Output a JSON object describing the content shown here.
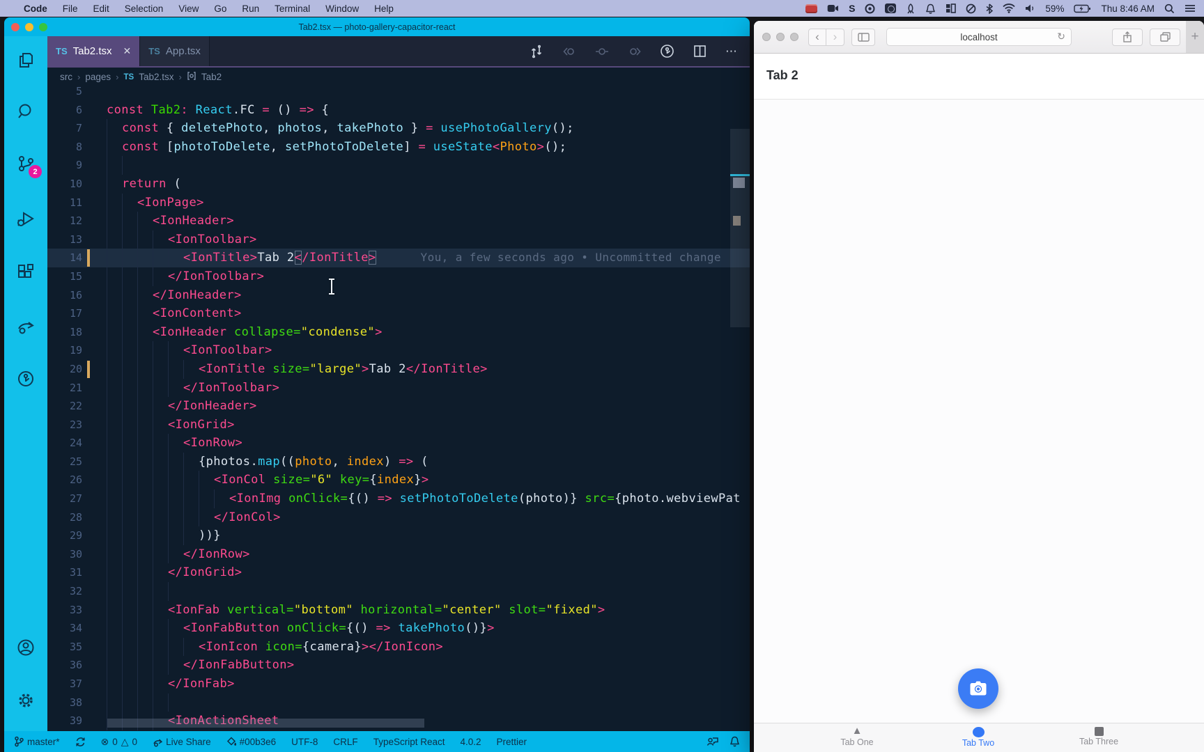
{
  "colors": {
    "accent_cyan": "#00b3e6",
    "tab_purple": "#57497c",
    "badge_magenta": "#e8189e",
    "fab_blue": "#3880ff",
    "ionic_active_blue": "#3478f6",
    "gutter_modified": "#d9a95e"
  },
  "menu_bar": {
    "apple": "",
    "menus": [
      "Code",
      "File",
      "Edit",
      "Selection",
      "View",
      "Go",
      "Run",
      "Terminal",
      "Window",
      "Help"
    ],
    "status_icons": [
      "film-icon",
      "video-camera-icon",
      "s-app-icon",
      "record-icon",
      "camera-square-icon",
      "rocket-icon",
      "bell-icon",
      "layout-icon",
      "slash-circle-icon",
      "bluetooth-icon",
      "wifi-icon",
      "volume-icon"
    ],
    "battery": "59%",
    "clock": "Thu 8:46 AM"
  },
  "vscode": {
    "window_title": "Tab2.tsx — photo-gallery-capacitor-react",
    "tabs": [
      {
        "icon": "TS",
        "label": "Tab2.tsx",
        "close": "✕",
        "active": true
      },
      {
        "icon": "TS",
        "label": "App.tsx",
        "active": false
      }
    ],
    "breadcrumb": [
      "src",
      "pages",
      "Tab2.tsx",
      "Tab2"
    ],
    "breadcrumb_ts": "TS",
    "activity_badge": "2",
    "editor": {
      "blame": "You, a few seconds ago • Uncommitted change",
      "lines": [
        {
          "n": 5,
          "i": 0,
          "t": []
        },
        {
          "n": 6,
          "i": 0,
          "t": [
            [
              "k",
              "const"
            ],
            [
              "w",
              " "
            ],
            [
              "g",
              "Tab2"
            ],
            [
              "k",
              ":"
            ],
            [
              "w",
              " "
            ],
            [
              "f",
              "React"
            ],
            [
              "w",
              ".FC "
            ],
            [
              "k",
              "="
            ],
            [
              "w",
              " () "
            ],
            [
              "k",
              "=>"
            ],
            [
              "w",
              " {"
            ]
          ]
        },
        {
          "n": 7,
          "i": 1,
          "t": [
            [
              "k",
              "const"
            ],
            [
              "w",
              " { "
            ],
            [
              "v",
              "deletePhoto"
            ],
            [
              "w",
              ", "
            ],
            [
              "v",
              "photos"
            ],
            [
              "w",
              ", "
            ],
            [
              "v",
              "takePhoto"
            ],
            [
              "w",
              " } "
            ],
            [
              "k",
              "="
            ],
            [
              "w",
              " "
            ],
            [
              "f",
              "usePhotoGallery"
            ],
            [
              "w",
              "();"
            ]
          ]
        },
        {
          "n": 8,
          "i": 1,
          "t": [
            [
              "k",
              "const"
            ],
            [
              "w",
              " ["
            ],
            [
              "v",
              "photoToDelete"
            ],
            [
              "w",
              ", "
            ],
            [
              "v",
              "setPhotoToDelete"
            ],
            [
              "w",
              "] "
            ],
            [
              "k",
              "="
            ],
            [
              "w",
              " "
            ],
            [
              "f",
              "useState"
            ],
            [
              "k",
              "<"
            ],
            [
              "o",
              "Photo"
            ],
            [
              "k",
              ">"
            ],
            [
              "w",
              "();"
            ]
          ]
        },
        {
          "n": 9,
          "i": 2,
          "t": []
        },
        {
          "n": 10,
          "i": 1,
          "t": [
            [
              "k",
              "return"
            ],
            [
              "w",
              " ("
            ]
          ]
        },
        {
          "n": 11,
          "i": 2,
          "t": [
            [
              "k",
              "<IonPage>"
            ]
          ]
        },
        {
          "n": 12,
          "i": 3,
          "t": [
            [
              "k",
              "<IonHeader>"
            ]
          ]
        },
        {
          "n": 13,
          "i": 4,
          "t": [
            [
              "k",
              "<IonToolbar>"
            ]
          ]
        },
        {
          "n": 14,
          "i": 5,
          "cur": true,
          "mod": true,
          "blame": true,
          "t": [
            [
              "k",
              "<IonTitle>"
            ],
            [
              "w",
              "Tab 2"
            ],
            [
              "b",
              "<"
            ],
            [
              "k",
              "/IonTitle"
            ],
            [
              "b",
              ">"
            ]
          ]
        },
        {
          "n": 15,
          "i": 4,
          "t": [
            [
              "k",
              "</IonToolbar>"
            ]
          ]
        },
        {
          "n": 16,
          "i": 3,
          "t": [
            [
              "k",
              "</IonHeader>"
            ]
          ]
        },
        {
          "n": 17,
          "i": 3,
          "t": [
            [
              "k",
              "<IonContent>"
            ]
          ]
        },
        {
          "n": 18,
          "i": 3,
          "t": [
            [
              "k",
              "<IonHeader"
            ],
            [
              "w",
              " "
            ],
            [
              "a",
              "collapse="
            ],
            [
              "s",
              "\"condense\""
            ],
            [
              "k",
              ">"
            ]
          ]
        },
        {
          "n": 19,
          "i": 5,
          "t": [
            [
              "k",
              "<IonToolbar>"
            ]
          ]
        },
        {
          "n": 20,
          "i": 6,
          "mod": true,
          "t": [
            [
              "k",
              "<IonTitle"
            ],
            [
              "w",
              " "
            ],
            [
              "a",
              "size="
            ],
            [
              "s",
              "\"large\""
            ],
            [
              "k",
              ">"
            ],
            [
              "w",
              "Tab 2"
            ],
            [
              "k",
              "</IonTitle>"
            ]
          ]
        },
        {
          "n": 21,
          "i": 5,
          "t": [
            [
              "k",
              "</IonToolbar>"
            ]
          ]
        },
        {
          "n": 22,
          "i": 4,
          "t": [
            [
              "k",
              "</IonHeader>"
            ]
          ]
        },
        {
          "n": 23,
          "i": 4,
          "t": [
            [
              "k",
              "<IonGrid>"
            ]
          ]
        },
        {
          "n": 24,
          "i": 5,
          "t": [
            [
              "k",
              "<IonRow>"
            ]
          ]
        },
        {
          "n": 25,
          "i": 6,
          "t": [
            [
              "w",
              "{photos."
            ],
            [
              "f",
              "map"
            ],
            [
              "w",
              "(("
            ],
            [
              "o",
              "photo"
            ],
            [
              "w",
              ", "
            ],
            [
              "o",
              "index"
            ],
            [
              "w",
              ") "
            ],
            [
              "k",
              "=>"
            ],
            [
              "w",
              " ("
            ]
          ]
        },
        {
          "n": 26,
          "i": 7,
          "t": [
            [
              "k",
              "<IonCol"
            ],
            [
              "w",
              " "
            ],
            [
              "a",
              "size="
            ],
            [
              "s",
              "\"6\""
            ],
            [
              "w",
              " "
            ],
            [
              "a",
              "key="
            ],
            [
              "w",
              "{"
            ],
            [
              "o",
              "index"
            ],
            [
              "w",
              "}"
            ],
            [
              "k",
              ">"
            ]
          ]
        },
        {
          "n": 27,
          "i": 8,
          "t": [
            [
              "k",
              "<IonImg"
            ],
            [
              "w",
              " "
            ],
            [
              "a",
              "onClick="
            ],
            [
              "w",
              "{() "
            ],
            [
              "k",
              "=>"
            ],
            [
              "w",
              " "
            ],
            [
              "f",
              "setPhotoToDelete"
            ],
            [
              "w",
              "(photo)} "
            ],
            [
              "a",
              "src="
            ],
            [
              "w",
              "{photo.webviewPat"
            ]
          ]
        },
        {
          "n": 28,
          "i": 7,
          "t": [
            [
              "k",
              "</IonCol>"
            ]
          ]
        },
        {
          "n": 29,
          "i": 6,
          "t": [
            [
              "w",
              "))}"
            ]
          ]
        },
        {
          "n": 30,
          "i": 5,
          "t": [
            [
              "k",
              "</IonRow>"
            ]
          ]
        },
        {
          "n": 31,
          "i": 4,
          "t": [
            [
              "k",
              "</IonGrid>"
            ]
          ]
        },
        {
          "n": 32,
          "i": 5,
          "t": []
        },
        {
          "n": 33,
          "i": 4,
          "t": [
            [
              "k",
              "<IonFab"
            ],
            [
              "w",
              " "
            ],
            [
              "a",
              "vertical="
            ],
            [
              "s",
              "\"bottom\""
            ],
            [
              "w",
              " "
            ],
            [
              "a",
              "horizontal="
            ],
            [
              "s",
              "\"center\""
            ],
            [
              "w",
              " "
            ],
            [
              "a",
              "slot="
            ],
            [
              "s",
              "\"fixed\""
            ],
            [
              "k",
              ">"
            ]
          ]
        },
        {
          "n": 34,
          "i": 5,
          "t": [
            [
              "k",
              "<IonFabButton"
            ],
            [
              "w",
              " "
            ],
            [
              "a",
              "onClick="
            ],
            [
              "w",
              "{() "
            ],
            [
              "k",
              "=>"
            ],
            [
              "w",
              " "
            ],
            [
              "f",
              "takePhoto"
            ],
            [
              "w",
              "()}"
            ],
            [
              "k",
              ">"
            ]
          ]
        },
        {
          "n": 35,
          "i": 6,
          "t": [
            [
              "k",
              "<IonIcon"
            ],
            [
              "w",
              " "
            ],
            [
              "a",
              "icon="
            ],
            [
              "w",
              "{camera}"
            ],
            [
              "k",
              "></IonIcon>"
            ]
          ]
        },
        {
          "n": 36,
          "i": 5,
          "t": [
            [
              "k",
              "</IonFabButton>"
            ]
          ]
        },
        {
          "n": 37,
          "i": 4,
          "t": [
            [
              "k",
              "</IonFab>"
            ]
          ]
        },
        {
          "n": 38,
          "i": 5,
          "t": []
        },
        {
          "n": 39,
          "i": 4,
          "t": [
            [
              "k",
              "<IonActionSheet"
            ]
          ]
        }
      ]
    },
    "status": {
      "branch": "master*",
      "errors": "0",
      "warnings": "0",
      "error_glyph": "⊗",
      "warning_glyph": "△",
      "live_share": "Live Share",
      "peacock_color": "#00b3e6",
      "encoding": "UTF-8",
      "eol": "CRLF",
      "language": "TypeScript React",
      "version": "4.0.2",
      "formatter": "Prettier"
    }
  },
  "safari": {
    "url": "localhost",
    "back_glyph": "‹",
    "forward_glyph": "›",
    "reload_glyph": "↻",
    "plus_glyph": "+",
    "heading": "Tab 2",
    "tabs": [
      {
        "label": "Tab One",
        "icon": "triangle",
        "active": false
      },
      {
        "label": "Tab Two",
        "icon": "ellipse",
        "active": true
      },
      {
        "label": "Tab Three",
        "icon": "square",
        "active": false
      }
    ]
  }
}
